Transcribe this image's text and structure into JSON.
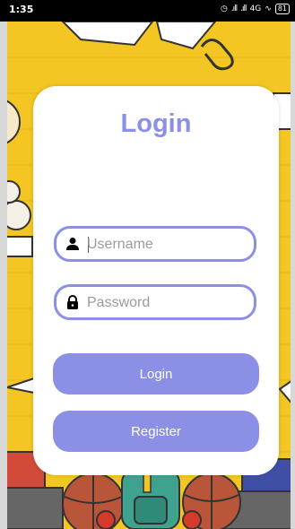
{
  "statusbar": {
    "time": "1:35",
    "network": "4G",
    "battery": "81"
  },
  "login": {
    "title": "Login",
    "username_placeholder": "Username",
    "password_placeholder": "Password",
    "login_label": "Login",
    "register_label": "Register"
  },
  "icons": {
    "user": "person-icon",
    "password": "lock-icon"
  },
  "colors": {
    "accent": "#8b8fe6",
    "background": "#f3c623",
    "card": "#ffffff"
  }
}
